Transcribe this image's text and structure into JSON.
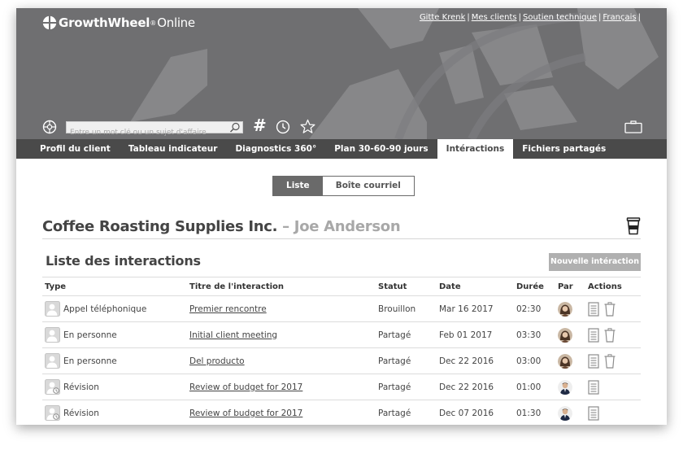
{
  "header": {
    "brand": "GrowthWheel",
    "brand_reg": "®",
    "brand_suffix": "Online",
    "links": [
      "Gitte Krenk",
      "Mes clients",
      "Soutien technique",
      "Français"
    ],
    "search_placeholder": "Entre un mot clé ou un sujet d'affaire",
    "icons": [
      "wheel-icon",
      "search-icon",
      "hashtag-icon",
      "clock-icon",
      "star-icon",
      "briefcase-icon"
    ],
    "hash_glyph": "#"
  },
  "tabs": [
    {
      "label": "Profil du client",
      "active": false
    },
    {
      "label": "Tableau indicateur",
      "active": false
    },
    {
      "label": "Diagnostics 360°",
      "active": false
    },
    {
      "label": "Plan 30-60-90 jours",
      "active": false
    },
    {
      "label": "Intéractions",
      "active": true
    },
    {
      "label": "Fichiers partagés",
      "active": false
    }
  ],
  "view_toggle": {
    "list": "Liste",
    "inbox": "Boîte courriel",
    "selected": "Liste"
  },
  "client": {
    "company": "Coffee Roasting Supplies Inc.",
    "separator": "–",
    "contact": "Joe Anderson"
  },
  "interactions": {
    "title": "Liste des interactions",
    "new_button": "Nouvelle intéraction",
    "columns": [
      "Type",
      "Titre de l'interaction",
      "Statut",
      "Date",
      "Durée",
      "Par",
      "Actions"
    ],
    "rows": [
      {
        "type": "Appel téléphonique",
        "title": "Premier rencontre",
        "status": "Brouillon",
        "date": "Mar 16 2017",
        "duration": "02:30",
        "by": "female-avatar",
        "deletable": true
      },
      {
        "type": "En personne",
        "title": "Initial client meeting",
        "status": "Partagé",
        "date": "Feb 01 2017",
        "duration": "03:30",
        "by": "female-avatar",
        "deletable": true
      },
      {
        "type": "En personne",
        "title": "Del producto",
        "status": "Partagé",
        "date": "Dec 22 2016",
        "duration": "03:00",
        "by": "female-avatar",
        "deletable": true
      },
      {
        "type": "Révision",
        "title": "Review of budget for 2017",
        "status": "Partagé",
        "date": "Dec 22 2016",
        "duration": "01:00",
        "by": "male-avatar",
        "deletable": false
      },
      {
        "type": "Révision",
        "title": "Review of budget for 2017",
        "status": "Partagé",
        "date": "Dec 07 2016",
        "duration": "01:30",
        "by": "male-avatar",
        "deletable": false
      }
    ]
  },
  "colors": {
    "header_bg": "#6f6f71",
    "tab_bar": "#4a4a4a",
    "button_grey": "#b0b0b0",
    "muted_text": "#a8a8a8"
  }
}
